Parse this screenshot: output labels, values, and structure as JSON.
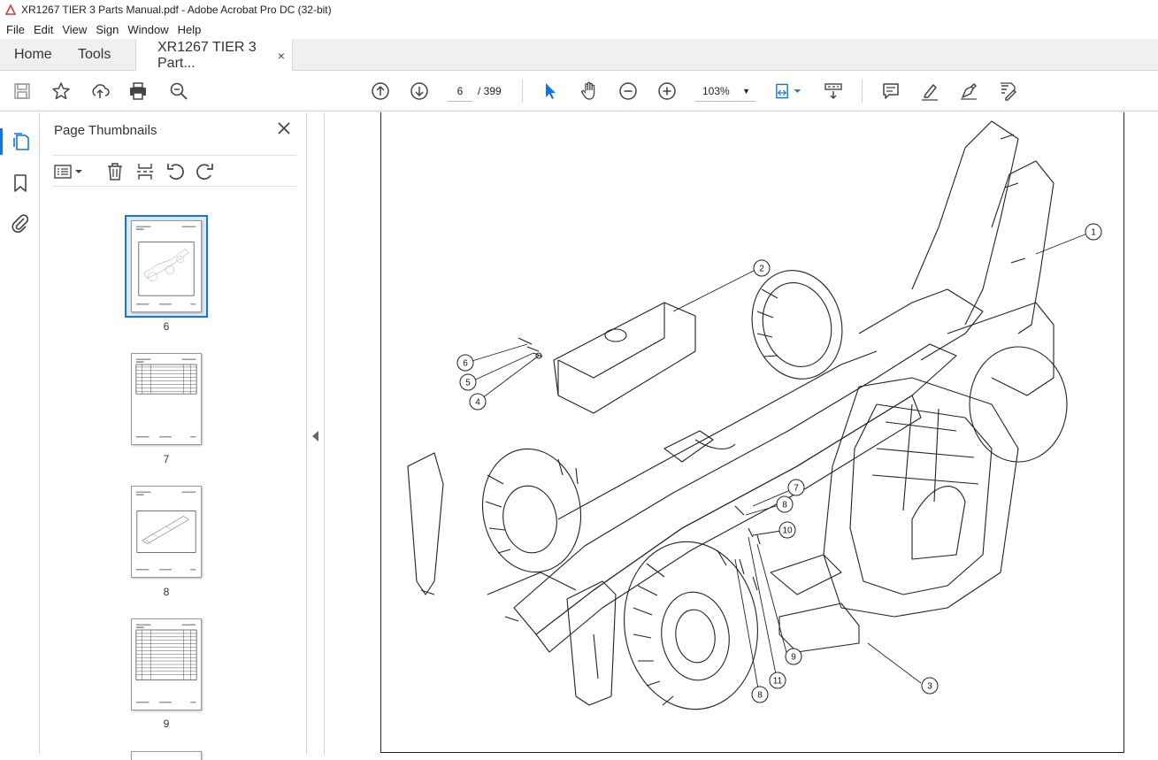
{
  "window": {
    "title": "XR1267 TIER 3 Parts Manual.pdf - Adobe Acrobat Pro DC (32-bit)"
  },
  "menu": [
    "File",
    "Edit",
    "View",
    "Sign",
    "Window",
    "Help"
  ],
  "tabs": {
    "home": "Home",
    "tools": "Tools",
    "document": "XR1267 TIER 3 Part...",
    "close": "×"
  },
  "toolbar": {
    "current_page": "6",
    "total_pages": "/ 399",
    "zoom": "103%"
  },
  "panel": {
    "title": "Page Thumbnails",
    "thumbnails": [
      {
        "label": "6",
        "selected": true
      },
      {
        "label": "7",
        "selected": false
      },
      {
        "label": "8",
        "selected": false
      },
      {
        "label": "9",
        "selected": false
      }
    ]
  },
  "drawing": {
    "callouts": [
      "1",
      "2",
      "3",
      "4",
      "5",
      "6",
      "7",
      "8",
      "9",
      "10",
      "11",
      "8"
    ]
  },
  "colors": {
    "accent": "#1473e6",
    "acrobat_red": "#d7373f"
  }
}
